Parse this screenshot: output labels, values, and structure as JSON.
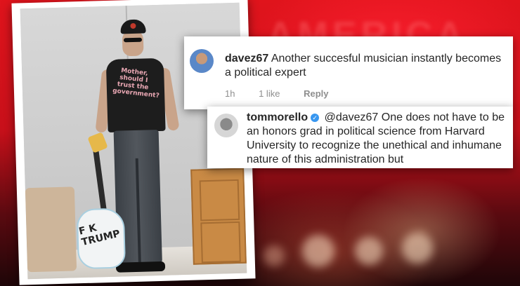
{
  "photo": {
    "shirt_text": "Mother, should I trust the government?",
    "guitar_text": "F K TRUMP"
  },
  "background": {
    "banner_text": "AMERICA"
  },
  "comments": [
    {
      "username": "davez67",
      "verified": false,
      "text": "Another succesful musician instantly becomes a political expert",
      "time": "1h",
      "likes": "1 like",
      "reply_label": "Reply"
    },
    {
      "username": "tommorello",
      "verified": true,
      "mention": "@davez67",
      "text": "One does not have to be an honors grad in political science from Harvard University to recognize the unethical and inhumane nature of this administration but"
    }
  ],
  "colors": {
    "verified_blue": "#3897f0",
    "background_red": "#e0141c"
  }
}
